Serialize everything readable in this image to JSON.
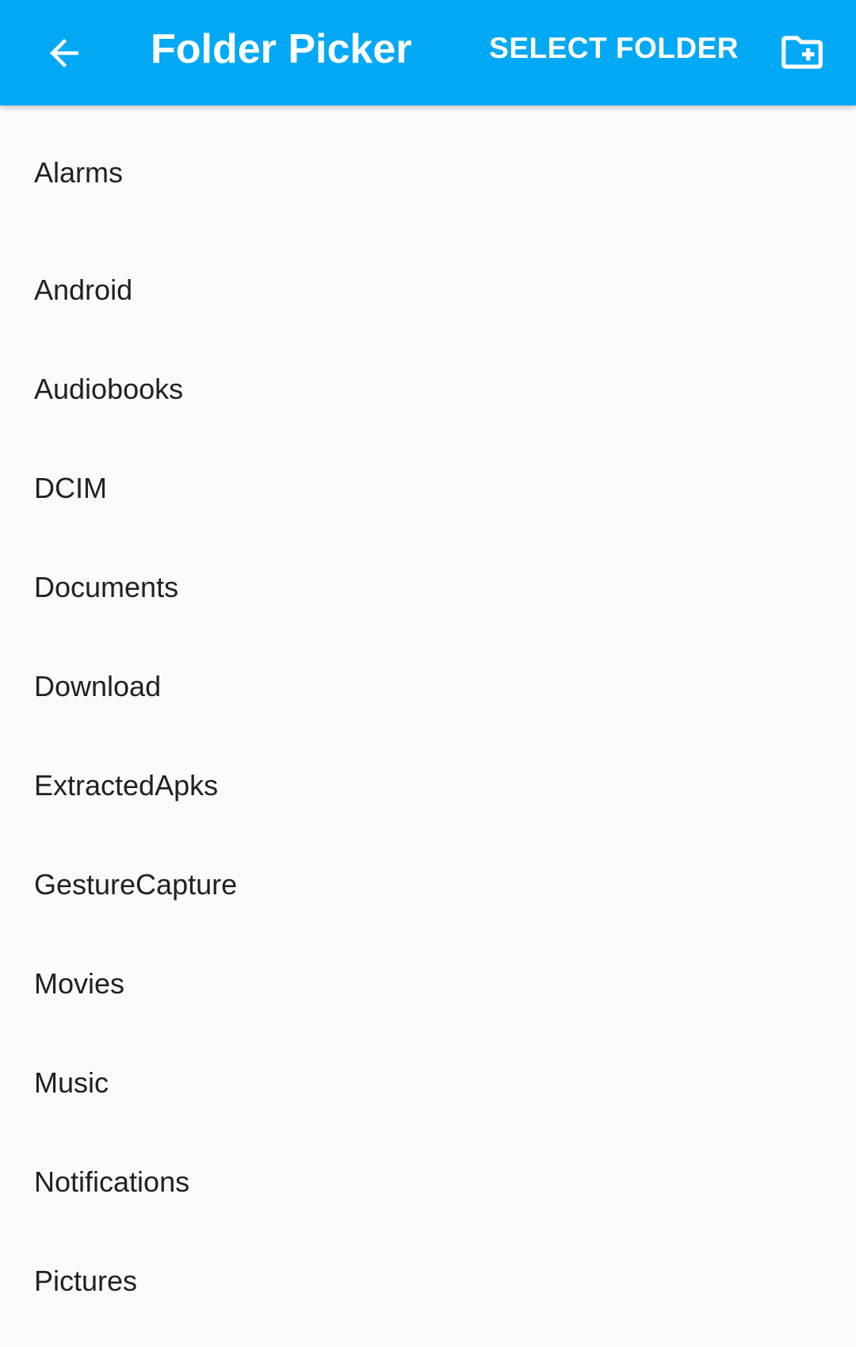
{
  "appbar": {
    "back_icon": "arrow-left-icon",
    "title": "Folder Picker",
    "select_label": "SELECT FOLDER",
    "new_folder_icon": "create-new-folder-icon",
    "background_color": "#03a9f4"
  },
  "folders": [
    "Alarms",
    "Android",
    "Audiobooks",
    "DCIM",
    "Documents",
    "Download",
    "ExtractedApks",
    "GestureCapture",
    "Movies",
    "Music",
    "Notifications",
    "Pictures"
  ]
}
